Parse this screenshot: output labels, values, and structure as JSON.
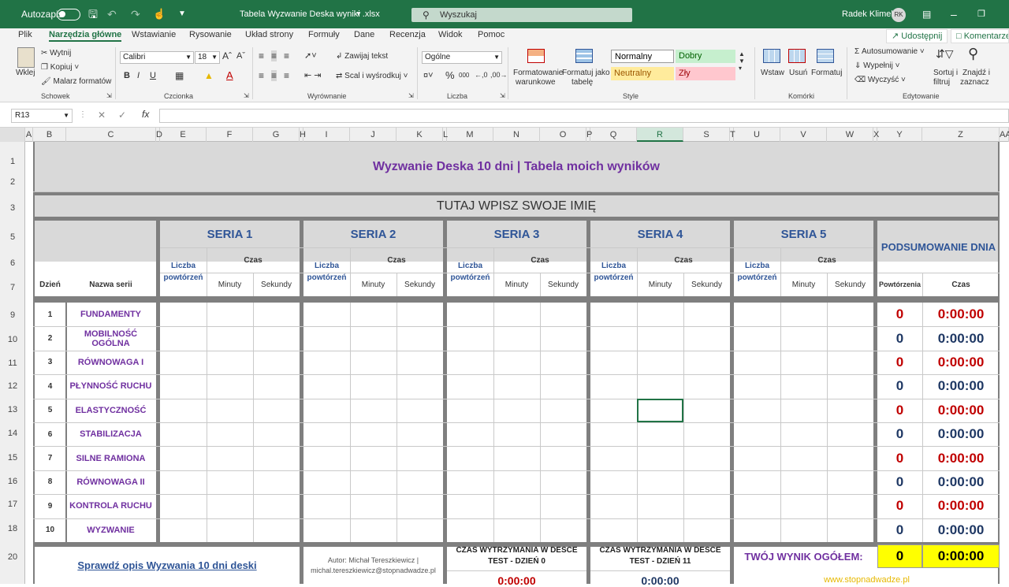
{
  "titlebar": {
    "autosave": "Autozapis",
    "filename": "Tabela Wyzwanie Deska wyniki .xlsx",
    "search_placeholder": "Wyszukaj",
    "user": "Radek Klimek",
    "initials": "RK"
  },
  "tabs": [
    "Plik",
    "Narzędzia główne",
    "Wstawianie",
    "Rysowanie",
    "Układ strony",
    "Formuły",
    "Dane",
    "Recenzja",
    "Widok",
    "Pomoc"
  ],
  "share_label": "Udostępnij",
  "comments_label": "Komentarze",
  "ribbon": {
    "clipboard": {
      "paste": "Wklej",
      "cut": "Wytnij",
      "copy": "Kopiuj",
      "painter": "Malarz formatów",
      "group": "Schowek"
    },
    "font": {
      "name": "Calibri",
      "size": "18",
      "group": "Czcionka"
    },
    "alignment": {
      "wrap": "Zawijaj tekst",
      "merge": "Scal i wyśrodkuj",
      "group": "Wyrównanie"
    },
    "number": {
      "format": "Ogólne",
      "group": "Liczba"
    },
    "styles": {
      "cond1": "Formatowanie",
      "cond2": "warunkowe",
      "table1": "Formatuj jako",
      "table2": "tabelę",
      "normal": "Normalny",
      "good": "Dobry",
      "neutral": "Neutralny",
      "bad": "Zły",
      "group": "Style"
    },
    "cells": {
      "insert": "Wstaw",
      "delete": "Usuń",
      "format": "Formatuj",
      "group": "Komórki"
    },
    "editing": {
      "autosum": "Autosumowanie",
      "fill": "Wypełnij",
      "clear": "Wyczyść",
      "sort1": "Sortuj i",
      "sort2": "filtruj",
      "find1": "Znajdź i",
      "find2": "zaznacz",
      "group": "Edytowanie"
    }
  },
  "namebox": "R13",
  "columns": [
    "A",
    "B",
    "C",
    "D",
    "E",
    "F",
    "G",
    "H",
    "I",
    "J",
    "K",
    "L",
    "M",
    "N",
    "O",
    "P",
    "Q",
    "R",
    "S",
    "T",
    "U",
    "V",
    "W",
    "X",
    "Y",
    "Z",
    "AA"
  ],
  "rows": [
    "1",
    "2",
    "3",
    "5",
    "6",
    "7",
    "9",
    "10",
    "11",
    "12",
    "13",
    "14",
    "15",
    "16",
    "17",
    "18",
    "20"
  ],
  "sheet": {
    "title": "Wyzwanie Deska 10 dni | Tabela moich  wyników",
    "name_prompt": "TUTAJ WPISZ SWOJE IMIĘ",
    "series": [
      "SERIA 1",
      "SERIA 2",
      "SERIA 3",
      "SERIA 4",
      "SERIA 5"
    ],
    "liczba": "Liczba powtórzeń",
    "czas": "Czas",
    "minuty": "Minuty",
    "sekundy": "Sekundy",
    "summary": "PODSUMOWANIE DNIA",
    "sum_reps": "Powtórzenia",
    "sum_time": "Czas",
    "day_header": "Dzień",
    "name_header": "Nazwa serii",
    "days": [
      {
        "n": "1",
        "name": "FUNDAMENTY",
        "reps": "0",
        "time": "0:00:00"
      },
      {
        "n": "2",
        "name": "MOBILNOŚĆ OGÓLNA",
        "reps": "0",
        "time": "0:00:00"
      },
      {
        "n": "3",
        "name": "RÓWNOWAGA I",
        "reps": "0",
        "time": "0:00:00"
      },
      {
        "n": "4",
        "name": "PŁYNNOŚĆ RUCHU",
        "reps": "0",
        "time": "0:00:00"
      },
      {
        "n": "5",
        "name": "ELASTYCZNOŚĆ",
        "reps": "0",
        "time": "0:00:00"
      },
      {
        "n": "6",
        "name": "STABILIZACJA",
        "reps": "0",
        "time": "0:00:00"
      },
      {
        "n": "7",
        "name": "SILNE RAMIONA",
        "reps": "0",
        "time": "0:00:00"
      },
      {
        "n": "8",
        "name": "RÓWNOWAGA II",
        "reps": "0",
        "time": "0:00:00"
      },
      {
        "n": "9",
        "name": "KONTROLA RUCHU",
        "reps": "0",
        "time": "0:00:00"
      },
      {
        "n": "10",
        "name": "WYZWANIE",
        "reps": "0",
        "time": "0:00:00"
      }
    ],
    "footer": {
      "link": "Sprawdź opis Wyzwania 10 dni deski",
      "author1": "Autor: Michał Tereszkiewicz |",
      "author2": "michal.tereszkiewicz@stopnadwadze.pl",
      "test0_1": "CZAS WYTRZYMANIA W DESCE",
      "test0_2": "TEST - DZIEŃ 0",
      "test0_val": "0:00:00",
      "test11_1": "CZAS WYTRZYMANIA W DESCE",
      "test11_2": "TEST - DZIEŃ 11",
      "test11_val": "0:00:00",
      "total_label": "TWÓJ WYNIK OGÓŁEM:",
      "total_reps": "0",
      "total_time": "0:00:00",
      "site": "www.stopnadwadze.pl"
    }
  },
  "colors": {
    "accent": "#217346",
    "purple": "#7030a0",
    "blue": "#2f5597",
    "red": "#c00000",
    "navy": "#1f3864",
    "yellow": "#ffff00"
  }
}
